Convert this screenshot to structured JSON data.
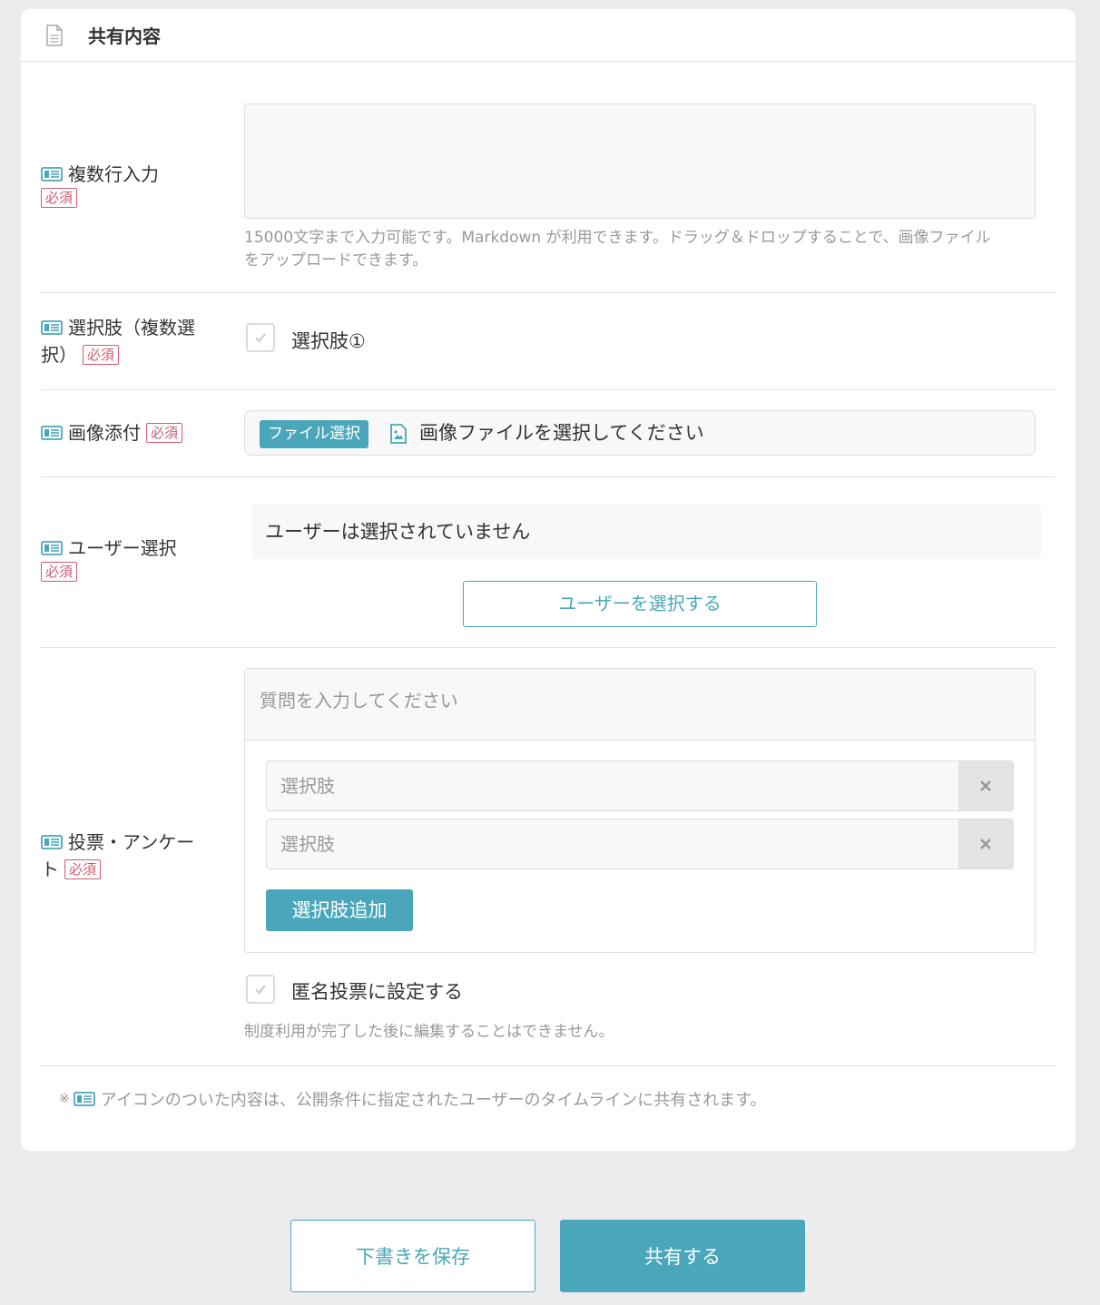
{
  "header": {
    "title": "共有内容"
  },
  "fields": {
    "multiline": {
      "label": "複数行入力",
      "required": "必須",
      "value": "",
      "help_line1": "15000文字まで入力可能です。Markdown が利用できます。ドラッグ＆ドロップすることで、画像ファイル",
      "help_line2": "をアップロードできます。"
    },
    "choice": {
      "label_line1": "選択肢（複数選",
      "label_line2": "択）",
      "required": "必須",
      "option": "選択肢①"
    },
    "image": {
      "label": "画像添付",
      "required": "必須",
      "button": "ファイル選択",
      "placeholder": "画像ファイルを選択してください"
    },
    "user": {
      "label": "ユーザー選択",
      "required": "必須",
      "empty_text": "ユーザーは選択されていません",
      "button": "ユーザーを選択する"
    },
    "poll": {
      "label_line1": "投票・アンケー",
      "label_line2": "ト",
      "required": "必須",
      "question_placeholder": "質問を入力してください",
      "options": [
        {
          "placeholder": "選択肢"
        },
        {
          "placeholder": "選択肢"
        }
      ],
      "add_button": "選択肢追加",
      "anonymous_label": "匿名投票に設定する",
      "note": "制度利用が完了した後に編集することはできません。"
    }
  },
  "footer_note": {
    "prefix": "※",
    "text": "アイコンのついた内容は、公開条件に指定されたユーザーのタイムラインに共有されます。"
  },
  "actions": {
    "save_draft": "下書きを保存",
    "share": "共有する"
  },
  "colors": {
    "accent": "#4aa7bb",
    "required": "#d05b73",
    "background": "#ececee"
  }
}
